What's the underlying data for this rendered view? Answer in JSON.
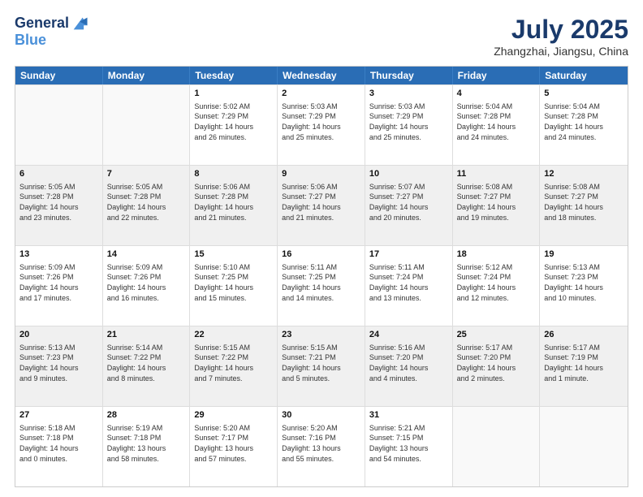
{
  "header": {
    "logo_line1": "General",
    "logo_line2": "Blue",
    "title": "July 2025",
    "subtitle": "Zhangzhai, Jiangsu, China"
  },
  "weekdays": [
    "Sunday",
    "Monday",
    "Tuesday",
    "Wednesday",
    "Thursday",
    "Friday",
    "Saturday"
  ],
  "rows": [
    [
      {
        "day": "",
        "info": "",
        "empty": true
      },
      {
        "day": "",
        "info": "",
        "empty": true
      },
      {
        "day": "1",
        "info": "Sunrise: 5:02 AM\nSunset: 7:29 PM\nDaylight: 14 hours\nand 26 minutes.",
        "empty": false
      },
      {
        "day": "2",
        "info": "Sunrise: 5:03 AM\nSunset: 7:29 PM\nDaylight: 14 hours\nand 25 minutes.",
        "empty": false
      },
      {
        "day": "3",
        "info": "Sunrise: 5:03 AM\nSunset: 7:29 PM\nDaylight: 14 hours\nand 25 minutes.",
        "empty": false
      },
      {
        "day": "4",
        "info": "Sunrise: 5:04 AM\nSunset: 7:28 PM\nDaylight: 14 hours\nand 24 minutes.",
        "empty": false
      },
      {
        "day": "5",
        "info": "Sunrise: 5:04 AM\nSunset: 7:28 PM\nDaylight: 14 hours\nand 24 minutes.",
        "empty": false
      }
    ],
    [
      {
        "day": "6",
        "info": "Sunrise: 5:05 AM\nSunset: 7:28 PM\nDaylight: 14 hours\nand 23 minutes.",
        "empty": false
      },
      {
        "day": "7",
        "info": "Sunrise: 5:05 AM\nSunset: 7:28 PM\nDaylight: 14 hours\nand 22 minutes.",
        "empty": false
      },
      {
        "day": "8",
        "info": "Sunrise: 5:06 AM\nSunset: 7:28 PM\nDaylight: 14 hours\nand 21 minutes.",
        "empty": false
      },
      {
        "day": "9",
        "info": "Sunrise: 5:06 AM\nSunset: 7:27 PM\nDaylight: 14 hours\nand 21 minutes.",
        "empty": false
      },
      {
        "day": "10",
        "info": "Sunrise: 5:07 AM\nSunset: 7:27 PM\nDaylight: 14 hours\nand 20 minutes.",
        "empty": false
      },
      {
        "day": "11",
        "info": "Sunrise: 5:08 AM\nSunset: 7:27 PM\nDaylight: 14 hours\nand 19 minutes.",
        "empty": false
      },
      {
        "day": "12",
        "info": "Sunrise: 5:08 AM\nSunset: 7:27 PM\nDaylight: 14 hours\nand 18 minutes.",
        "empty": false
      }
    ],
    [
      {
        "day": "13",
        "info": "Sunrise: 5:09 AM\nSunset: 7:26 PM\nDaylight: 14 hours\nand 17 minutes.",
        "empty": false
      },
      {
        "day": "14",
        "info": "Sunrise: 5:09 AM\nSunset: 7:26 PM\nDaylight: 14 hours\nand 16 minutes.",
        "empty": false
      },
      {
        "day": "15",
        "info": "Sunrise: 5:10 AM\nSunset: 7:25 PM\nDaylight: 14 hours\nand 15 minutes.",
        "empty": false
      },
      {
        "day": "16",
        "info": "Sunrise: 5:11 AM\nSunset: 7:25 PM\nDaylight: 14 hours\nand 14 minutes.",
        "empty": false
      },
      {
        "day": "17",
        "info": "Sunrise: 5:11 AM\nSunset: 7:24 PM\nDaylight: 14 hours\nand 13 minutes.",
        "empty": false
      },
      {
        "day": "18",
        "info": "Sunrise: 5:12 AM\nSunset: 7:24 PM\nDaylight: 14 hours\nand 12 minutes.",
        "empty": false
      },
      {
        "day": "19",
        "info": "Sunrise: 5:13 AM\nSunset: 7:23 PM\nDaylight: 14 hours\nand 10 minutes.",
        "empty": false
      }
    ],
    [
      {
        "day": "20",
        "info": "Sunrise: 5:13 AM\nSunset: 7:23 PM\nDaylight: 14 hours\nand 9 minutes.",
        "empty": false
      },
      {
        "day": "21",
        "info": "Sunrise: 5:14 AM\nSunset: 7:22 PM\nDaylight: 14 hours\nand 8 minutes.",
        "empty": false
      },
      {
        "day": "22",
        "info": "Sunrise: 5:15 AM\nSunset: 7:22 PM\nDaylight: 14 hours\nand 7 minutes.",
        "empty": false
      },
      {
        "day": "23",
        "info": "Sunrise: 5:15 AM\nSunset: 7:21 PM\nDaylight: 14 hours\nand 5 minutes.",
        "empty": false
      },
      {
        "day": "24",
        "info": "Sunrise: 5:16 AM\nSunset: 7:20 PM\nDaylight: 14 hours\nand 4 minutes.",
        "empty": false
      },
      {
        "day": "25",
        "info": "Sunrise: 5:17 AM\nSunset: 7:20 PM\nDaylight: 14 hours\nand 2 minutes.",
        "empty": false
      },
      {
        "day": "26",
        "info": "Sunrise: 5:17 AM\nSunset: 7:19 PM\nDaylight: 14 hours\nand 1 minute.",
        "empty": false
      }
    ],
    [
      {
        "day": "27",
        "info": "Sunrise: 5:18 AM\nSunset: 7:18 PM\nDaylight: 14 hours\nand 0 minutes.",
        "empty": false
      },
      {
        "day": "28",
        "info": "Sunrise: 5:19 AM\nSunset: 7:18 PM\nDaylight: 13 hours\nand 58 minutes.",
        "empty": false
      },
      {
        "day": "29",
        "info": "Sunrise: 5:20 AM\nSunset: 7:17 PM\nDaylight: 13 hours\nand 57 minutes.",
        "empty": false
      },
      {
        "day": "30",
        "info": "Sunrise: 5:20 AM\nSunset: 7:16 PM\nDaylight: 13 hours\nand 55 minutes.",
        "empty": false
      },
      {
        "day": "31",
        "info": "Sunrise: 5:21 AM\nSunset: 7:15 PM\nDaylight: 13 hours\nand 54 minutes.",
        "empty": false
      },
      {
        "day": "",
        "info": "",
        "empty": true
      },
      {
        "day": "",
        "info": "",
        "empty": true
      }
    ]
  ]
}
